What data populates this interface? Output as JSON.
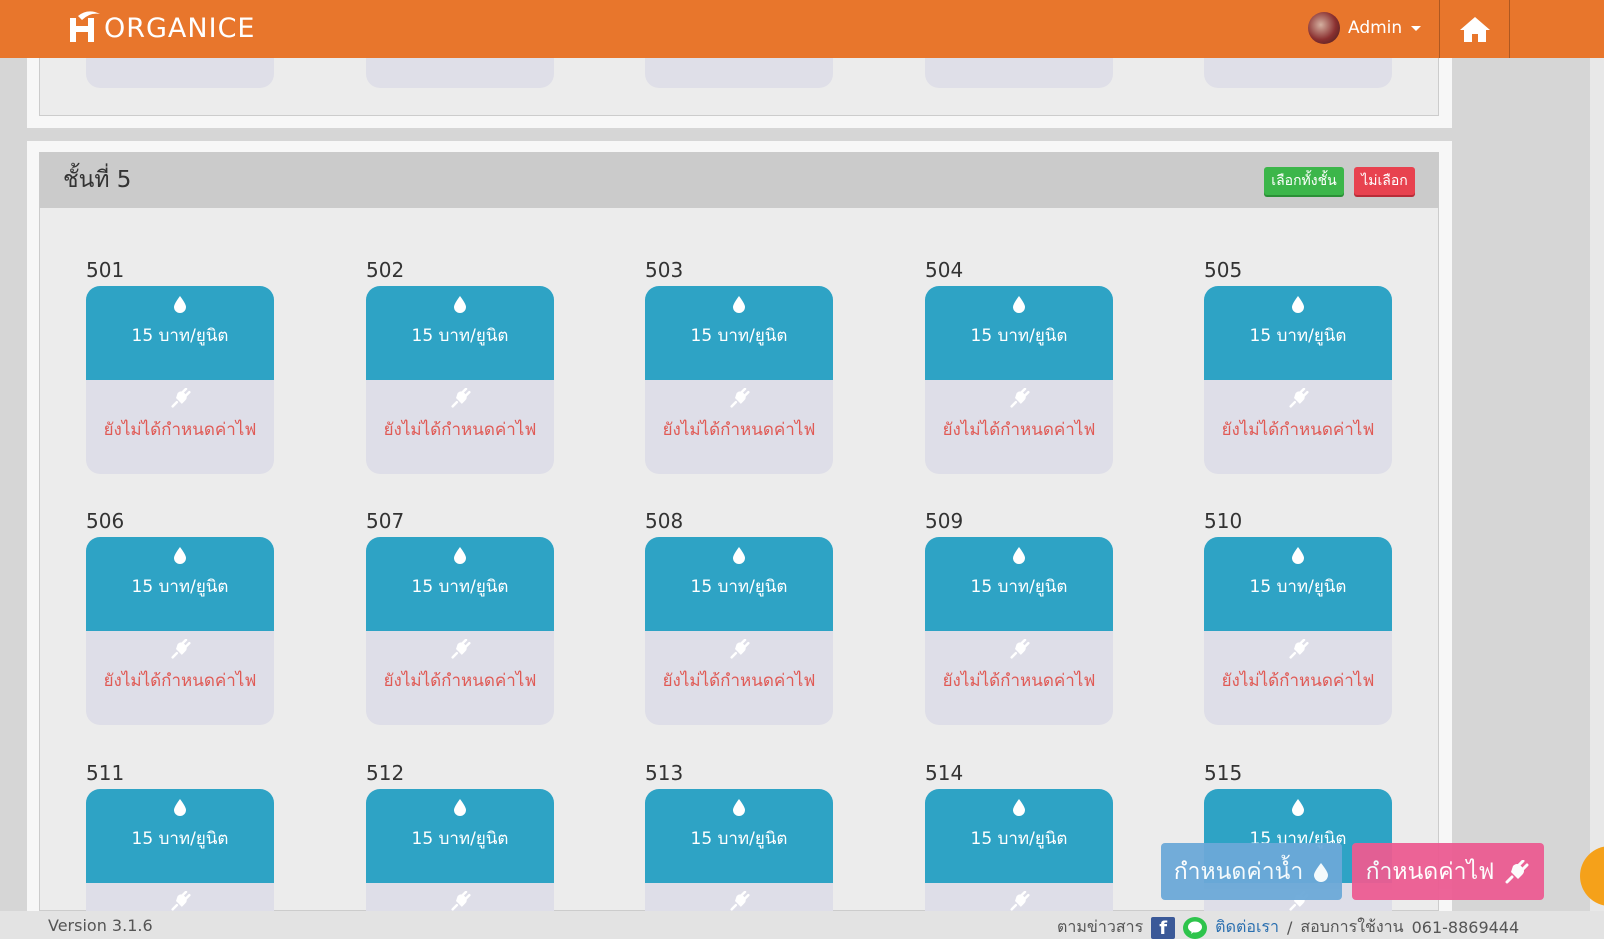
{
  "navbar": {
    "brand": "ORGANICE",
    "user_name": "Admin"
  },
  "floor": {
    "title": "ชั้นที่ 5",
    "select_all_label": "เลือกทั้งชั้น",
    "deselect_label": "ไม่เลือก"
  },
  "rooms": [
    {
      "number": "501",
      "water": "15 บาท/ยูนิต",
      "electric": "ยังไม่ได้กำหนดค่าไฟ"
    },
    {
      "number": "502",
      "water": "15 บาท/ยูนิต",
      "electric": "ยังไม่ได้กำหนดค่าไฟ"
    },
    {
      "number": "503",
      "water": "15 บาท/ยูนิต",
      "electric": "ยังไม่ได้กำหนดค่าไฟ"
    },
    {
      "number": "504",
      "water": "15 บาท/ยูนิต",
      "electric": "ยังไม่ได้กำหนดค่าไฟ"
    },
    {
      "number": "505",
      "water": "15 บาท/ยูนิต",
      "electric": "ยังไม่ได้กำหนดค่าไฟ"
    },
    {
      "number": "506",
      "water": "15 บาท/ยูนิต",
      "electric": "ยังไม่ได้กำหนดค่าไฟ"
    },
    {
      "number": "507",
      "water": "15 บาท/ยูนิต",
      "electric": "ยังไม่ได้กำหนดค่าไฟ"
    },
    {
      "number": "508",
      "water": "15 บาท/ยูนิต",
      "electric": "ยังไม่ได้กำหนดค่าไฟ"
    },
    {
      "number": "509",
      "water": "15 บาท/ยูนิต",
      "electric": "ยังไม่ได้กำหนดค่าไฟ"
    },
    {
      "number": "510",
      "water": "15 บาท/ยูนิต",
      "electric": "ยังไม่ได้กำหนดค่าไฟ"
    },
    {
      "number": "511",
      "water": "15 บาท/ยูนิต",
      "electric": ""
    },
    {
      "number": "512",
      "water": "15 บาท/ยูนิต",
      "electric": ""
    },
    {
      "number": "513",
      "water": "15 บาท/ยูนิต",
      "electric": ""
    },
    {
      "number": "514",
      "water": "15 บาท/ยูนิต",
      "electric": ""
    },
    {
      "number": "515",
      "water": "15 บาท/ยูนิต",
      "electric": ""
    }
  ],
  "actions": {
    "set_water_label": "กำหนดค่าน้ำ",
    "set_electric_label": "กำหนดค่าไฟ"
  },
  "footer": {
    "version": "Version 3.1.6",
    "follow_news": "ตามข่าวสาร",
    "contact": "ติดต่อเรา",
    "separator": "/",
    "usage_inquiry": "สอบการใช้งาน",
    "phone": "061-8869444"
  },
  "colors": {
    "navbar": "#e8762c",
    "water_card": "#2ea3c5",
    "electric_card": "#dedee8",
    "electric_text": "#e05a55",
    "select_all": "#3cb64a",
    "deselect": "#e8424f",
    "fab_water": "#6ca9d8",
    "fab_electric": "#ec5c92"
  },
  "icons": {
    "water": "water-drop-icon",
    "electric": "plug-icon",
    "home": "home-icon"
  }
}
